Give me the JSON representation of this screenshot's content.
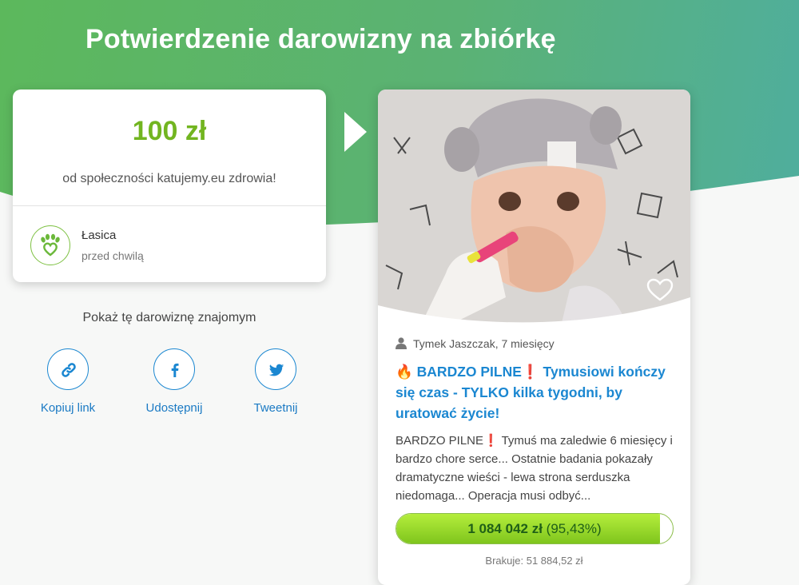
{
  "page": {
    "title": "Potwierdzenie darowizny na zbiórkę"
  },
  "donation": {
    "amount": "100 zł",
    "from_text": "od społeczności katujemy.eu zdrowia!",
    "donor_name": "Łasica",
    "time": "przed chwilą"
  },
  "share": {
    "heading": "Pokaż tę darowiznę znajomym",
    "buttons": [
      {
        "label": "Kopiuj link",
        "icon": "link-icon"
      },
      {
        "label": "Udostępnij",
        "icon": "facebook-icon"
      },
      {
        "label": "Tweetnij",
        "icon": "twitter-icon"
      }
    ]
  },
  "campaign": {
    "author": "Tymek Jaszczak, 7 miesięcy",
    "title": "🔥 BARDZO PILNE❗ Tymusiowi kończy się czas - TYLKO kilka tygodni, by uratować życie!",
    "description": "BARDZO PILNE❗ Tymuś ma zaledwie 6 miesięcy i bardzo chore serce... Ostatnie badania pokazały dramatyczne wieści - lewa strona serduszka niedomaga... Operacja musi odbyć...",
    "raised": "1 084 042 zł",
    "percent_label": "(95,43%)",
    "progress_fraction": 0.9543,
    "missing": "Brakuje: 51 884,52 zł"
  },
  "colors": {
    "brand_green": "#5cb85c",
    "amount_green": "#72b520",
    "link_blue": "#1b87d1"
  }
}
